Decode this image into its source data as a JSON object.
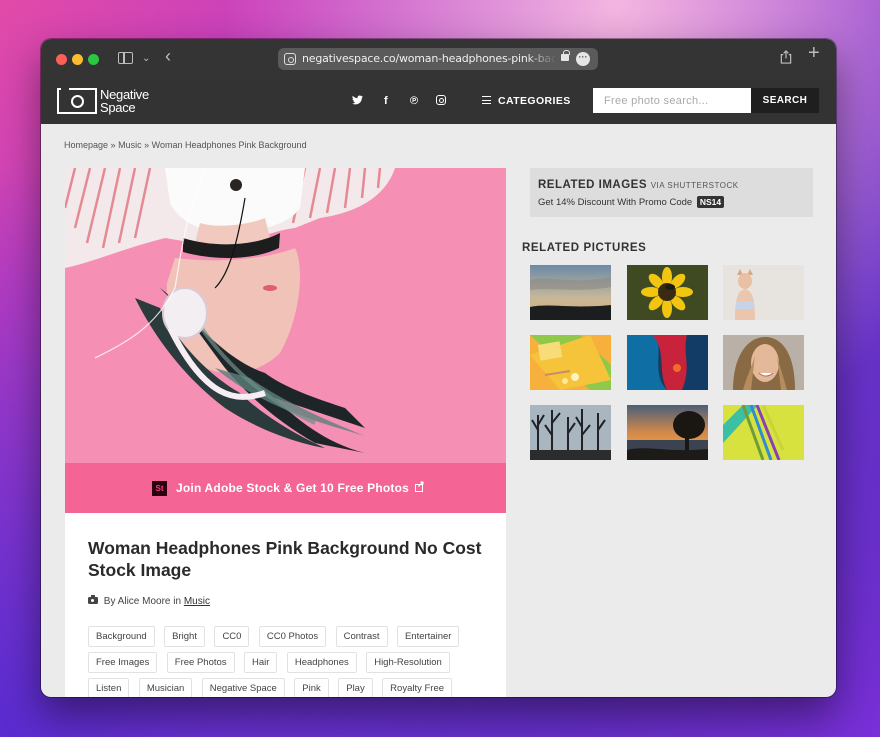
{
  "browser": {
    "url": "negativespace.co/woman-headphones-pink-background/"
  },
  "site": {
    "logo_line1": "Negative",
    "logo_line2": "Space",
    "social": [
      "twitter",
      "facebook",
      "pinterest",
      "instagram"
    ],
    "categories_label": "CATEGORIES",
    "search_placeholder": "Free photo search...",
    "search_button": "SEARCH"
  },
  "breadcrumb": {
    "home": "Homepage",
    "sep": "»",
    "music": "Music",
    "current": "Woman Headphones Pink Background"
  },
  "promo": {
    "logo_text": "St",
    "text": "Join Adobe Stock & Get 10 Free Photos"
  },
  "photo": {
    "title": "Woman Headphones Pink Background No Cost Stock Image",
    "by_prefix": "By Alice Moore in",
    "category": "Music",
    "tags": [
      "Background",
      "Bright",
      "CC0",
      "CC0 Photos",
      "Contrast",
      "Entertainer",
      "Free Images",
      "Free Photos",
      "Hair",
      "Headphones",
      "High-Resolution",
      "Listen",
      "Musician",
      "Negative Space",
      "Pink",
      "Play",
      "Royalty Free"
    ]
  },
  "sidebar": {
    "related_title": "RELATED IMAGES",
    "related_via": "VIA SHUTTERSTOCK",
    "discount_text": "Get 14% Discount With Promo Code",
    "promo_code": "NS14",
    "related_pictures_heading": "RELATED PICTURES",
    "thumbs": [
      "sunset-landscape",
      "yellow-flower-bee",
      "woman-cat-mask",
      "sticky-notes",
      "colorful-abstract",
      "smiling-woman",
      "bare-trees",
      "sunset-tree",
      "colored-pencils"
    ]
  },
  "colors": {
    "header_bg": "#333333",
    "promo_pink": "#f46595",
    "hero_pink": "#f590b4"
  }
}
